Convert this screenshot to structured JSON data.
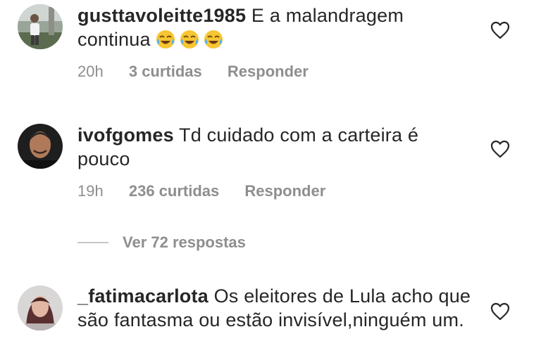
{
  "comments": [
    {
      "username": "gusttavoleitte1985",
      "text": " E a malandragem continua",
      "emojis": [
        "tears-of-joy-emoji",
        "tears-of-joy-emoji",
        "tears-of-joy-emoji"
      ],
      "time": "20h",
      "likes": "3 curtidas",
      "reply": "Responder"
    },
    {
      "username": "ivofgomes",
      "text": " Td cuidado com a carteira é pouco",
      "time": "19h",
      "likes": "236 curtidas",
      "reply": "Responder",
      "view_replies": "Ver 72 respostas"
    },
    {
      "username": "_fatimacarlota",
      "text": " Os eleitores de Lula acho que são fantasma ou estão invisível,ninguém um."
    }
  ],
  "icons": {
    "like": "heart-outline-icon"
  },
  "colors": {
    "text": "#262626",
    "secondary": "#8e8e8e",
    "divider": "#c7c7c7"
  }
}
